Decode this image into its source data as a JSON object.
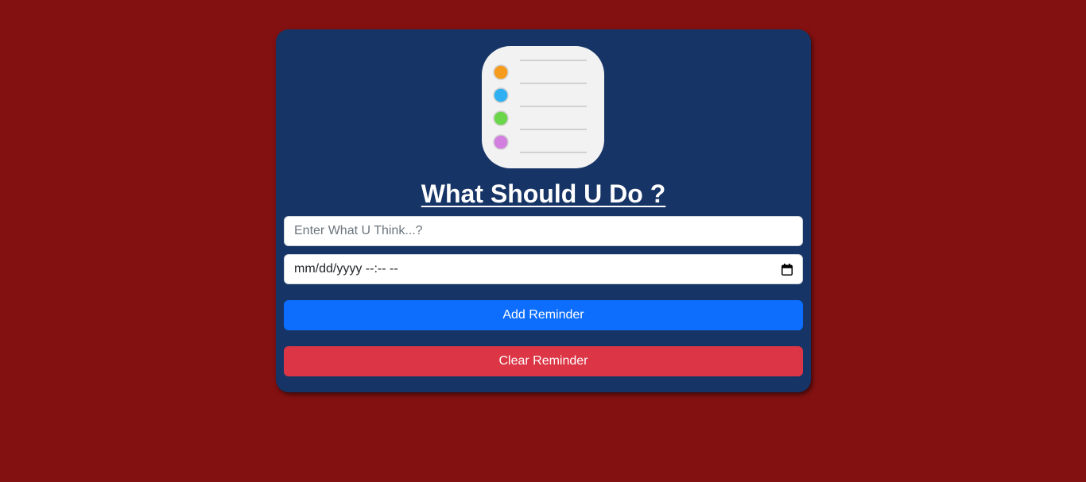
{
  "app": {
    "title": "What Should U Do ?"
  },
  "form": {
    "reminder_placeholder": "Enter What U Think...?",
    "reminder_value": "",
    "datetime_placeholder": "mm/dd/yyyy --:-- --",
    "datetime_value": ""
  },
  "buttons": {
    "add_label": "Add Reminder",
    "clear_label": "Clear Reminder"
  },
  "icons": {
    "app_logo": "reminders-list-icon",
    "calendar": "calendar-icon"
  },
  "colors": {
    "page_background": "#841111",
    "card_background": "#163466",
    "add_button": "#0d6efd",
    "clear_button": "#dc3545",
    "logo_dots": [
      "#f79b1c",
      "#2eb0f2",
      "#6cd64b",
      "#d27fe0"
    ]
  }
}
